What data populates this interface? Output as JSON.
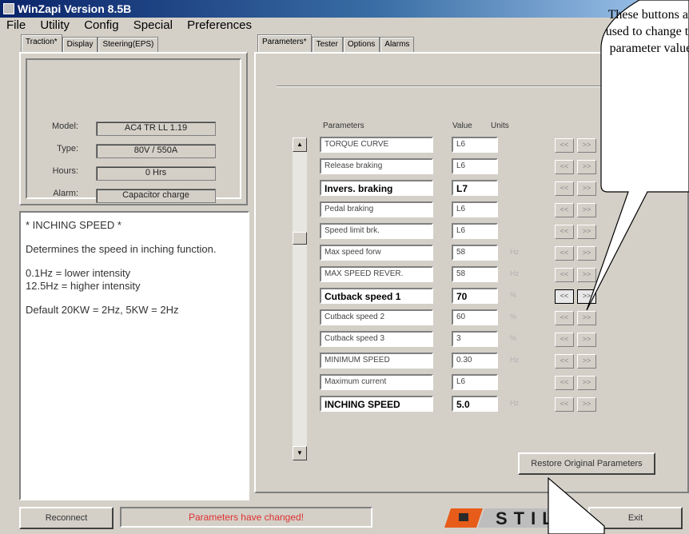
{
  "window": {
    "title": "WinZapi Version 8.5B"
  },
  "menu": [
    "File",
    "Utility",
    "Config",
    "Special",
    "Preferences"
  ],
  "left_tabs": [
    "Traction*",
    "Display",
    "Steering(EPS)"
  ],
  "info": {
    "model_label": "Model:",
    "model_value": "AC4 TR LL 1.19",
    "type_label": "Type:",
    "type_value": "80V / 550A",
    "hours_label": "Hours:",
    "hours_value": "0 Hrs",
    "alarm_label": "Alarm:",
    "alarm_value": "Capacitor charge"
  },
  "help": {
    "title": "* INCHING SPEED *",
    "para1": "Determines the speed in inching function.",
    "para2a": "0.1Hz = lower intensity",
    "para2b": "12.5Hz = higher intensity",
    "para3": "Default 20KW = 2Hz, 5KW = 2Hz"
  },
  "right_tabs": [
    "Parameters*",
    "Tester",
    "Options",
    "Alarms"
  ],
  "columns": {
    "parameters": "Parameters",
    "value": "Value",
    "units": "Units"
  },
  "parameters": [
    {
      "name": "TORQUE CURVE",
      "value": "L6",
      "unit": ""
    },
    {
      "name": "Release braking",
      "value": "L6",
      "unit": ""
    },
    {
      "name": "Invers. braking",
      "value": "L7",
      "unit": ""
    },
    {
      "name": "Pedal braking",
      "value": "L6",
      "unit": ""
    },
    {
      "name": "Speed limit brk.",
      "value": "L6",
      "unit": ""
    },
    {
      "name": "Max speed forw",
      "value": "58",
      "unit": "Hz"
    },
    {
      "name": "MAX SPEED REVER.",
      "value": "58",
      "unit": "Hz"
    },
    {
      "name": "Cutback speed 1",
      "value": "70",
      "unit": "%"
    },
    {
      "name": "Cutback speed 2",
      "value": "60",
      "unit": "%"
    },
    {
      "name": "Cutback speed 3",
      "value": "3",
      "unit": "%"
    },
    {
      "name": "MINIMUM SPEED",
      "value": "0.30",
      "unit": "Hz"
    },
    {
      "name": "Maximum current",
      "value": "L6",
      "unit": ""
    },
    {
      "name": "INCHING SPEED",
      "value": "5.0",
      "unit": "Hz"
    }
  ],
  "arrows": {
    "left": "<<",
    "right": ">>"
  },
  "buttons": {
    "restore": "Restore Original Parameters",
    "reconnect": "Reconnect",
    "exit": "Exit"
  },
  "status": "Parameters have changed!",
  "logo": {
    "text": "STILL",
    "accent": "#e85c1a"
  },
  "callout": "These buttons are used to change the parameter values"
}
